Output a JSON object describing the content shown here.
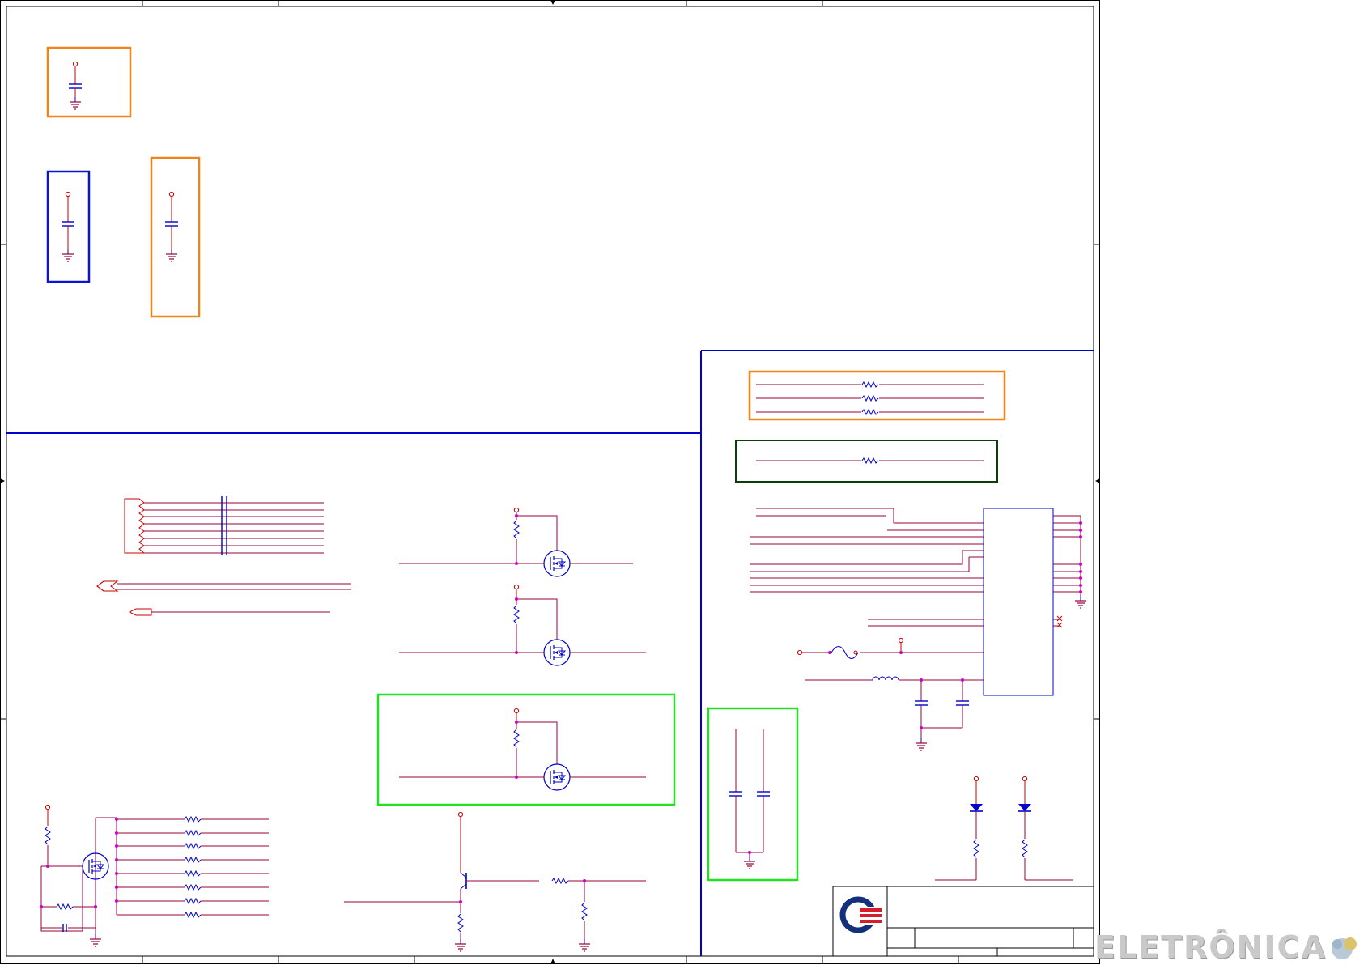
{
  "sheet": {
    "background": "#ffffff",
    "colors": {
      "frame": "#000000",
      "net_wire": "#990033",
      "pin_stub": "#cc0000",
      "component": "#0000cc",
      "junction": "#cc00cc",
      "section_divider": "#0000cc",
      "box_orange": "#f0841a",
      "box_blue": "#0a14d2",
      "box_green": "#22e022",
      "box_dark_green": "#0b3d0b",
      "logo_blue": "#13317b",
      "logo_red": "#d81d2a"
    },
    "text_labels": [],
    "highlight_boxes": [
      "orange",
      "blue",
      "orange",
      "orange",
      "dark-green",
      "green",
      "green"
    ]
  },
  "title_block": {
    "logo": "company-logo-icon",
    "fields": []
  },
  "watermark": {
    "text": "ELETRÔNICA",
    "logo": "watermark-logo-icon"
  }
}
